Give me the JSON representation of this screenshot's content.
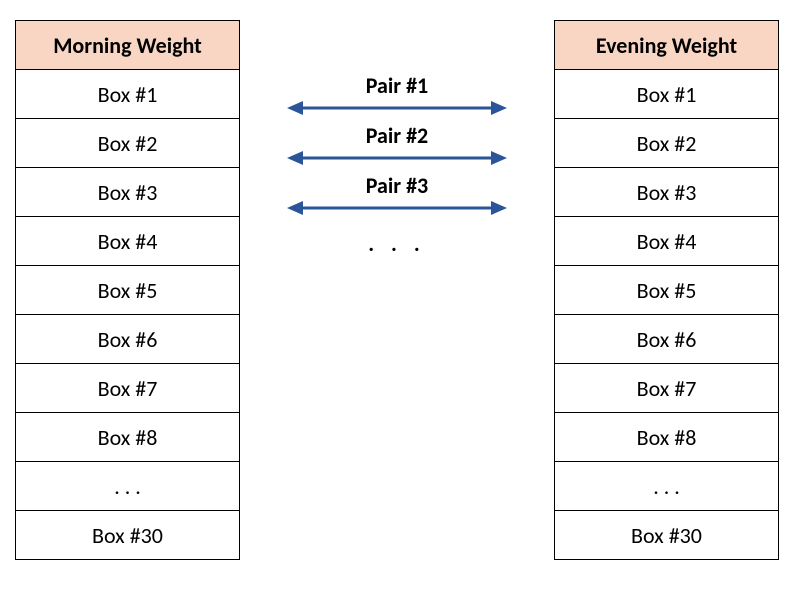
{
  "left": {
    "header": "Morning Weight",
    "rows": [
      "Box #1",
      "Box #2",
      "Box #3",
      "Box #4",
      "Box #5",
      "Box #6",
      "Box #7",
      "Box #8",
      ". . .",
      "Box #30"
    ]
  },
  "right": {
    "header": "Evening Weight",
    "rows": [
      "Box #1",
      "Box #2",
      "Box #3",
      "Box #4",
      "Box #5",
      "Box #6",
      "Box #7",
      "Box #8",
      ". . .",
      "Box #30"
    ]
  },
  "pairs": {
    "labels": [
      "Pair #1",
      "Pair #2",
      "Pair #3"
    ],
    "ellipsis": ". . ."
  },
  "colors": {
    "header_bg": "#f9d6c4",
    "arrow": "#2a5599"
  }
}
